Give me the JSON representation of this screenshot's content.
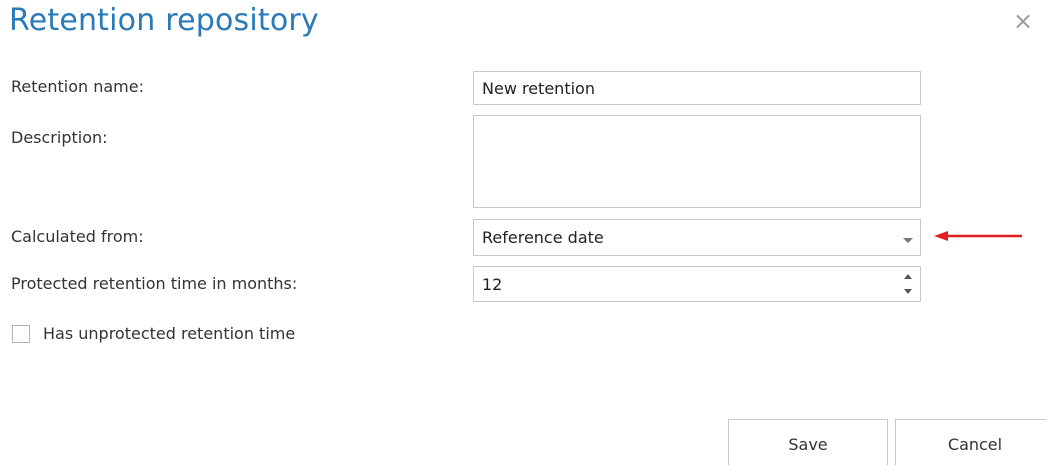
{
  "dialog": {
    "title": "Retention repository",
    "close_icon": "close-icon"
  },
  "form": {
    "retention_name_label": "Retention name:",
    "retention_name_value": "New retention",
    "description_label": "Description:",
    "description_value": "",
    "calculated_from_label": "Calculated from:",
    "calculated_from_value": "Reference date",
    "protected_time_label": "Protected retention time in months:",
    "protected_time_value": "12",
    "unprotected_checkbox_label": "Has unprotected retention time",
    "unprotected_checked": false
  },
  "buttons": {
    "save_label": "Save",
    "cancel_label": "Cancel"
  },
  "colors": {
    "title": "#2a7ab8",
    "annotation_arrow": "#e02020"
  }
}
